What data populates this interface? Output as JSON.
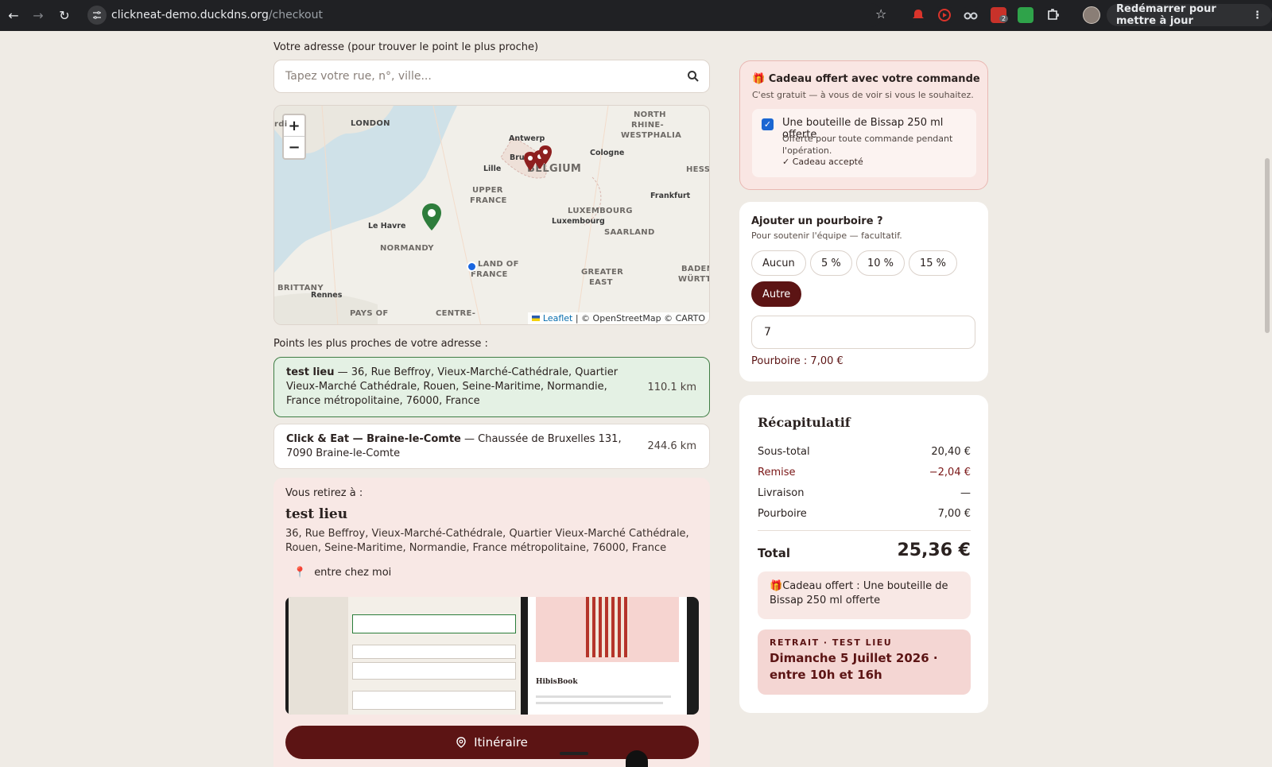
{
  "browser": {
    "url_host": "clickneat-demo.duckdns.org",
    "url_path": "/checkout",
    "update_label": "Redémarrer pour mettre à jour",
    "ext_badge": "2"
  },
  "address": {
    "label": "Votre adresse (pour trouver le point le plus proche)",
    "placeholder": "Tapez votre rue, n°, ville..."
  },
  "map": {
    "labels": {
      "london": "LONDON",
      "north_rhine": "NORTH",
      "north_rhine2": "RHINE-",
      "north_rhine3": "WESTPHALIA",
      "antwerp": "Antwerp",
      "brussels": "Brus",
      "belgium": "BELGIUM",
      "cologne": "Cologne",
      "lille": "Lille",
      "hesse": "HESSE",
      "upper_france": "UPPER",
      "upper_france2": "FRANCE",
      "frankfurt": "Frankfurt",
      "luxembourg": "LUXEMBOURG",
      "luxembourg_city": "Luxembourg",
      "le_havre": "Le Havre",
      "saarland": "SAARLAND",
      "normandy": "NORMANDY",
      "idf": "LAND OF",
      "idf2": "FRANCE",
      "greater_east": "GREATER",
      "greater_east2": "EAST",
      "baden": "BADEN",
      "baden2": "WÜRTTEM",
      "brittany": "BRITTANY",
      "rennes": "Rennes",
      "pays": "PAYS OF",
      "centre": "CENTRE-",
      "edge": "rdi"
    },
    "zoom_in": "+",
    "zoom_out": "−",
    "attribution_leaflet": "Leaflet",
    "attribution_rest": "| © OpenStreetMap © CARTO"
  },
  "nearest": {
    "label": "Points les plus proches de votre adresse :",
    "items": [
      {
        "name": "test lieu",
        "address": "36, Rue Beffroy, Vieux-Marché-Cathédrale, Quartier Vieux-Marché Cathédrale, Rouen, Seine-Maritime, Normandie, France métropolitaine, 76000, France",
        "distance": "110.1 km"
      },
      {
        "name": "Click & Eat — Braine-le-Comte",
        "address": "Chaussée de Bruxelles 131, 7090 Braine-le-Comte",
        "distance": "244.6 km"
      }
    ]
  },
  "pickup": {
    "head": "Vous retirez à :",
    "name": "test lieu",
    "address": "36, Rue Beffroy, Vieux-Marché-Cathédrale, Quartier Vieux-Marché Cathédrale, Rouen, Seine-Maritime, Normandie, France métropolitaine, 76000, France",
    "note": "entre chez moi",
    "route_button": "Itinéraire",
    "photo_book_title": "HibisBook"
  },
  "gift": {
    "title": "Cadeau offert avec votre commande",
    "subtitle": "C'est gratuit — à vous de voir si vous le souhaitez.",
    "item_name": "Une bouteille de Bissap 250 ml offerte",
    "item_desc": "Offerte pour toute commande pendant l'opération.",
    "accepted": "✓ Cadeau accepté"
  },
  "tip": {
    "title": "Ajouter un pourboire ?",
    "subtitle": "Pour soutenir l'équipe — facultatif.",
    "options": [
      "Aucun",
      "5 %",
      "10 %",
      "15 %",
      "Autre"
    ],
    "selected": "Autre",
    "value": "7",
    "summary": "Pourboire : 7,00 €"
  },
  "recap": {
    "title": "Récapitulatif",
    "rows": [
      {
        "label": "Sous-total",
        "value": "20,40 €"
      },
      {
        "label": "Remise",
        "value": "−2,04 €"
      },
      {
        "label": "Livraison",
        "value": "—"
      },
      {
        "label": "Pourboire",
        "value": "7,00 €"
      }
    ],
    "total_label": "Total",
    "total_value": "25,36 €",
    "gift_note": "Cadeau offert : Une bouteille de Bissap 250 ml offerte",
    "retrait_title": "RETRAIT · TEST LIEU",
    "retrait_date": "Dimanche 5 Juillet 2026 · entre 10h et 16h"
  },
  "colors": {
    "brand": "#5c1414",
    "selected_card": "#e4f1e4",
    "map_marker_green": "#2e7d3c",
    "map_marker_red": "#8e1f1f",
    "user_location": "#1a66e0"
  }
}
